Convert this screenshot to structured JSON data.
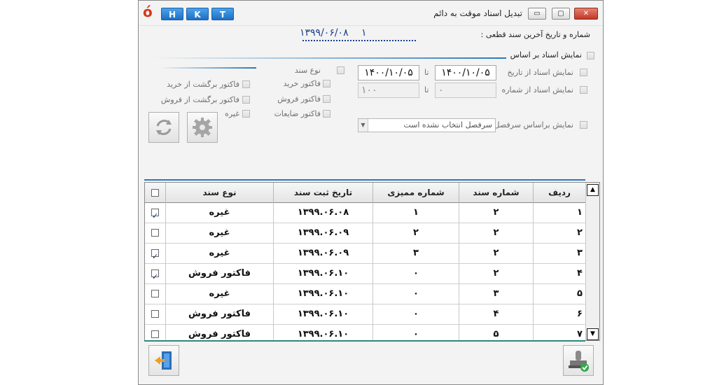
{
  "window": {
    "title": "تبدیل اسناد موقت به دائم",
    "hkt": [
      "H",
      "K",
      "T"
    ],
    "controls": {
      "minimize": "▭",
      "maximize": "▢",
      "close": "✕"
    }
  },
  "last_doc": {
    "label": "شماره و تاریخ آخرین سند قطعی :",
    "date": "۱۳۹۹/۰۶/۰۸",
    "number": "۱"
  },
  "filters": {
    "show_by_basis_label": "نمایش اسناد بر اساس",
    "from_date_label": "نمایش اسناد از تاریخ",
    "from_number_label": "نمایش اسناد از شماره",
    "to_label": "تا",
    "from_date": "۱۴۰۰/۱۰/۰۵",
    "to_date": "۱۴۰۰/۱۰/۰۵",
    "from_number": "۰",
    "to_number": "۱۰۰",
    "by_heading_label": "نمایش براساس سرفصل",
    "heading_placeholder": "سرفصل انتخاب نشده است"
  },
  "doc_types": {
    "title": "نوع سند",
    "items": [
      "فاکتور خرید",
      "فاکتور فروش",
      "فاکتور ضایعات",
      "فاکتور برگشت از خرید",
      "فاکتور برگشت از فروش",
      "غیره"
    ]
  },
  "grid": {
    "columns": [
      "ردیف",
      "شماره سند",
      "شماره ممیزی",
      "تاریخ ثبت سند",
      "نوع سند"
    ],
    "rows": [
      {
        "row": "۱",
        "doc_no": "۲",
        "audit_no": "۱",
        "date": "۱۳۹۹.۰۶.۰۸",
        "type": "غیره",
        "checked": true
      },
      {
        "row": "۲",
        "doc_no": "۲",
        "audit_no": "۲",
        "date": "۱۳۹۹.۰۶.۰۹",
        "type": "غیره",
        "checked": false
      },
      {
        "row": "۳",
        "doc_no": "۲",
        "audit_no": "۳",
        "date": "۱۳۹۹.۰۶.۰۹",
        "type": "غیره",
        "checked": true
      },
      {
        "row": "۴",
        "doc_no": "۲",
        "audit_no": "۰",
        "date": "۱۳۹۹.۰۶.۱۰",
        "type": "فاکتور فروش",
        "checked": true
      },
      {
        "row": "۵",
        "doc_no": "۳",
        "audit_no": "۰",
        "date": "۱۳۹۹.۰۶.۱۰",
        "type": "غیره",
        "checked": false
      },
      {
        "row": "۶",
        "doc_no": "۴",
        "audit_no": "۰",
        "date": "۱۳۹۹.۰۶.۱۰",
        "type": "فاکتور فروش",
        "checked": false
      },
      {
        "row": "۷",
        "doc_no": "۵",
        "audit_no": "۰",
        "date": "۱۳۹۹.۰۶.۱۰",
        "type": "فاکتور فروش",
        "checked": false
      }
    ]
  },
  "colors": {
    "accent": "#2a78b8",
    "title_logo": "#d43a1a",
    "teal": "#2a8a7a"
  }
}
